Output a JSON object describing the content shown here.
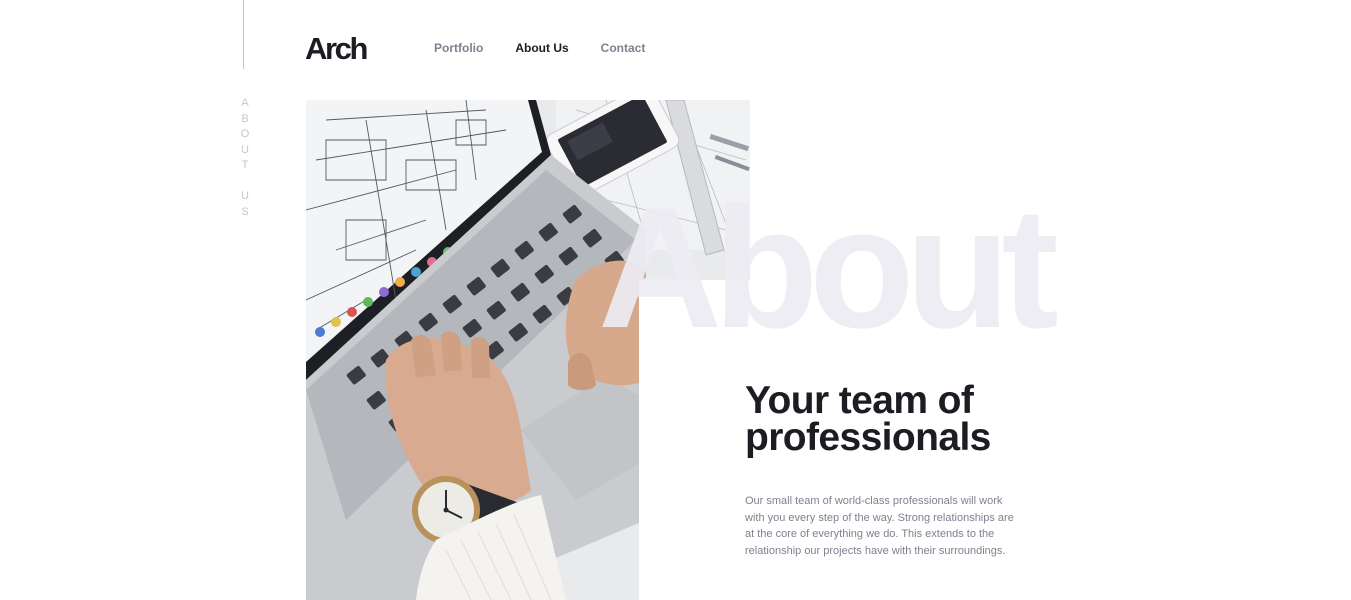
{
  "sidebar": {
    "label": "About Us"
  },
  "header": {
    "logo": "Arch",
    "nav": [
      {
        "label": "Portfolio",
        "active": false
      },
      {
        "label": "About Us",
        "active": true
      },
      {
        "label": "Contact",
        "active": false
      }
    ]
  },
  "hero": {
    "background_word": "About",
    "headline_line1": "Your team of",
    "headline_line2": "professionals",
    "body": "Our small team of world-class professionals will work with you every step of the way. Strong relationships are at the core of everything we do. This extends to the relationship our projects have with their surroundings.",
    "image_alt": "Hand typing on a laptop keyboard with architectural blueprints on screen"
  },
  "colors": {
    "text_dark": "#1b1d23",
    "text_muted": "#7d828f",
    "rail": "#c5c6ce",
    "watermark": "#ebecf2"
  }
}
